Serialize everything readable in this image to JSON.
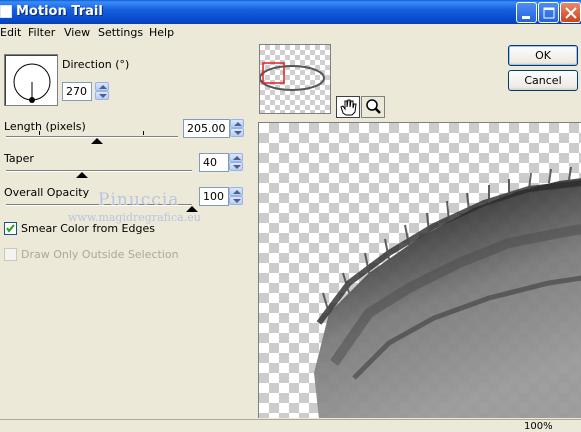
{
  "window": {
    "title": "Motion Trail"
  },
  "menu": [
    "Edit",
    "Filter",
    "View",
    "Settings",
    "Help"
  ],
  "direction": {
    "label": "Direction (°)",
    "value": "270"
  },
  "length": {
    "label": "Length (pixels)",
    "value": "205.00"
  },
  "taper": {
    "label": "Taper",
    "value": "40"
  },
  "opacity": {
    "label": "Overall Opacity",
    "value": "100"
  },
  "options": {
    "smear_label": "Smear Color from Edges",
    "smear_checked": true,
    "outside_label": "Draw Only Outside Selection",
    "outside_checked": false
  },
  "watermark": {
    "name": "Pinuccia",
    "site": "www.magidregrafica.eu"
  },
  "buttons": {
    "ok": "OK",
    "cancel": "Cancel"
  },
  "tools": [
    "hand-tool-icon",
    "zoom-tool-icon"
  ],
  "status": {
    "zoom": "100%"
  },
  "colors": {
    "titlebar": "#0a5fd8",
    "face": "#ece9d8",
    "accent": "#003c74"
  }
}
